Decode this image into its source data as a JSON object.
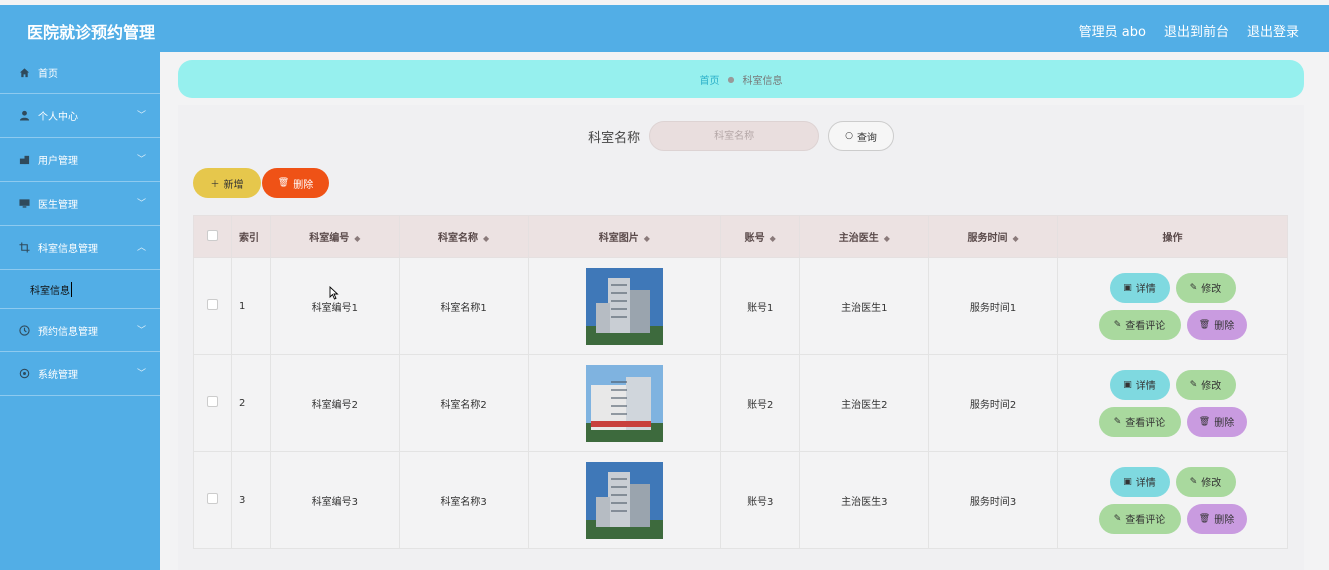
{
  "header": {
    "title": "医院就诊预约管理",
    "admin": "管理员 abo",
    "back_to_front": "退出到前台",
    "logout": "退出登录"
  },
  "sidebar": {
    "items": [
      {
        "label": "首页",
        "icon": "home-icon"
      },
      {
        "label": "个人中心",
        "icon": "user-icon"
      },
      {
        "label": "用户管理",
        "icon": "users-icon"
      },
      {
        "label": "医生管理",
        "icon": "monitor-icon"
      },
      {
        "label": "科室信息管理",
        "icon": "crop-icon"
      },
      {
        "label": "预约信息管理",
        "icon": "clock-icon"
      },
      {
        "label": "系统管理",
        "icon": "settings-icon"
      }
    ],
    "submenu": "科室信息"
  },
  "breadcrumb": {
    "home": "首页",
    "current": "科室信息"
  },
  "search": {
    "label": "科室名称",
    "placeholder": "科室名称",
    "button": "查询"
  },
  "actions": {
    "add": "新增",
    "delete": "删除"
  },
  "table": {
    "headers": [
      "索引",
      "科室编号",
      "科室名称",
      "科室图片",
      "账号",
      "主治医生",
      "服务时间",
      "操作"
    ],
    "rows": [
      {
        "idx": "1",
        "code": "科室编号1",
        "name": "科室名称1",
        "account": "账号1",
        "doctor": "主治医生1",
        "time": "服务时间1"
      },
      {
        "idx": "2",
        "code": "科室编号2",
        "name": "科室名称2",
        "account": "账号2",
        "doctor": "主治医生2",
        "time": "服务时间2"
      },
      {
        "idx": "3",
        "code": "科室编号3",
        "name": "科室名称3",
        "account": "账号3",
        "doctor": "主治医生3",
        "time": "服务时间3"
      }
    ],
    "ops": {
      "detail": "详情",
      "edit": "修改",
      "review": "查看评论",
      "delete": "删除"
    }
  }
}
